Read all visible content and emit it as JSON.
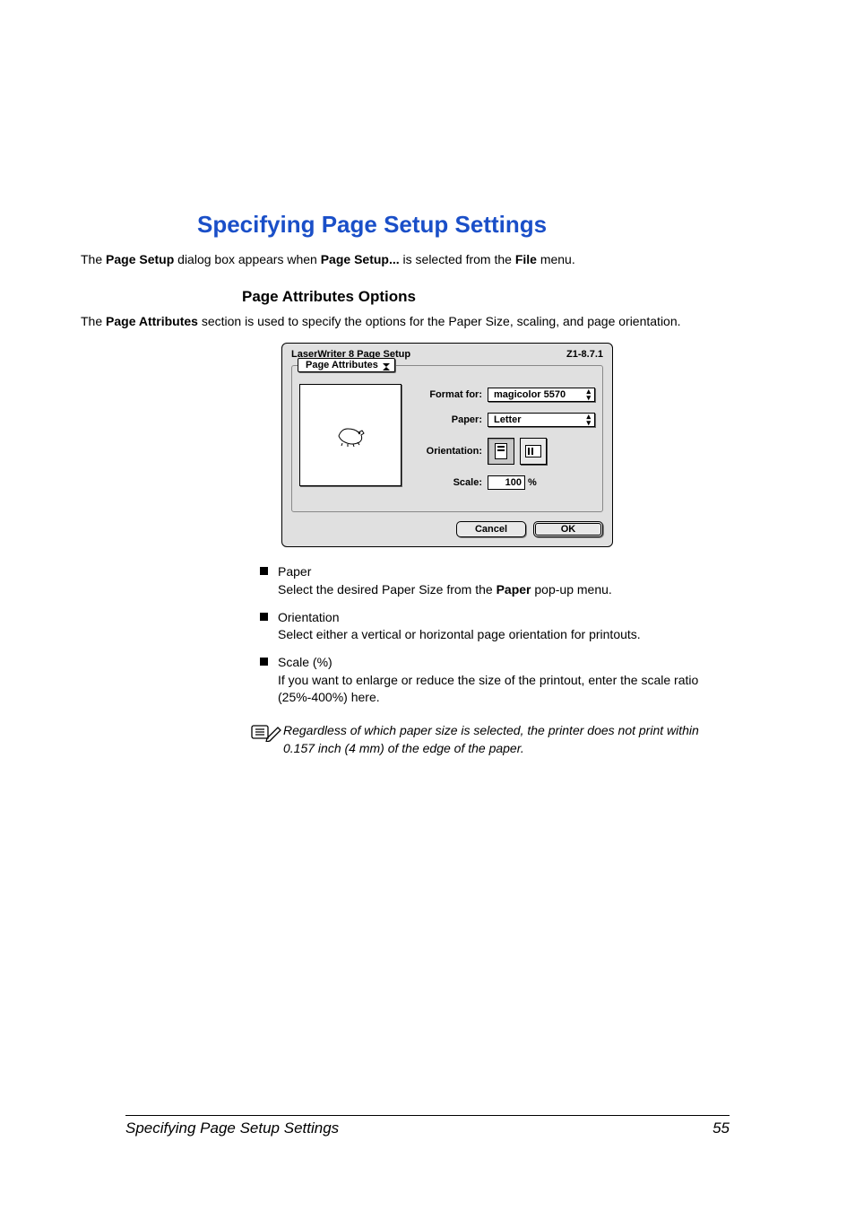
{
  "heading": "Specifying Page Setup Settings",
  "intro": {
    "pre": "The ",
    "bold1": "Page Setup",
    "mid1": " dialog box appears when ",
    "bold2": "Page Setup...",
    "mid2": " is selected from the ",
    "bold3": "File",
    "post": " menu."
  },
  "subhead": "Page Attributes Options",
  "attr_intro": {
    "pre": "The ",
    "bold": "Page Attributes",
    "post": " section is used to specify the options for the Paper Size, scaling, and page orientation."
  },
  "dialog": {
    "title": "LaserWriter 8 Page Setup",
    "version": "Z1-8.7.1",
    "tab": "Page Attributes",
    "format_label": "Format for:",
    "format_value": "magicolor 5570",
    "paper_label": "Paper:",
    "paper_value": "Letter",
    "orientation_label": "Orientation:",
    "scale_label": "Scale:",
    "scale_value": "100",
    "scale_unit": "%",
    "cancel": "Cancel",
    "ok": "OK"
  },
  "bullets": [
    {
      "title": "Paper",
      "desc_pre": "Select the desired Paper Size from the ",
      "desc_bold": "Paper",
      "desc_post": " pop-up menu."
    },
    {
      "title": "Orientation",
      "desc": "Select either a vertical or horizontal page orientation for printouts."
    },
    {
      "title": "Scale (%)",
      "desc": "If you want to enlarge or reduce the size of the printout, enter the scale ratio (25%-400%) here."
    }
  ],
  "note": "Regardless of which paper size is selected, the printer does not print within 0.157 inch (4 mm) of the edge of the paper.",
  "footer_left": "Specifying Page Setup Settings",
  "footer_right": "55"
}
